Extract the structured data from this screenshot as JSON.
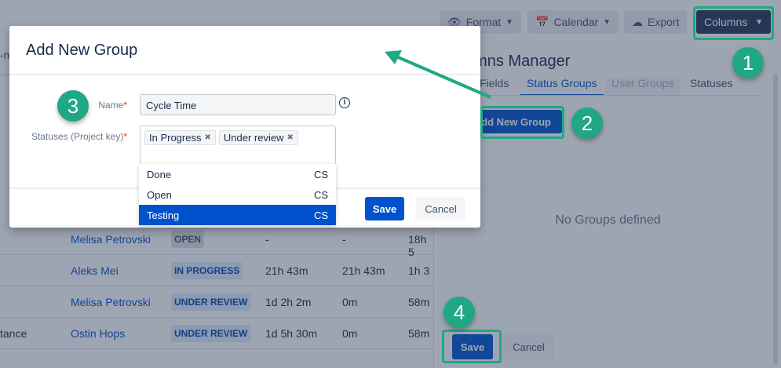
{
  "toolbar": {
    "format": "Format",
    "calendar": "Calendar",
    "export": "Export",
    "columns": "Columns"
  },
  "table": {
    "rows": [
      {
        "summary": "",
        "assignee": "Melisa Petrovski",
        "status": "OPEN",
        "status_color": "gray",
        "c1": "-",
        "c2": "-",
        "c3": "18h 5"
      },
      {
        "summary": "",
        "assignee": "Aleks Mei",
        "status": "IN PROGRESS",
        "status_color": "blue",
        "c1": "21h 43m",
        "c2": "21h 43m",
        "c3": "1h 3"
      },
      {
        "summary": "",
        "assignee": "Melisa Petrovski",
        "status": "UNDER REVIEW",
        "status_color": "blue",
        "c1": "1d 2h 2m",
        "c2": "0m",
        "c3": "58m"
      },
      {
        "summary": "tance",
        "assignee": "Ostin Hops",
        "status": "UNDER REVIEW",
        "status_color": "blue",
        "c1": "1d 5h 30m",
        "c2": "0m",
        "c3": "58m"
      }
    ],
    "left_fragment": "-m"
  },
  "panel": {
    "title": "Columns Manager",
    "tabs": [
      "Fields",
      "Status Groups",
      "User Groups",
      "Statuses"
    ],
    "active_tab": "Status Groups",
    "add_button": "Add New Group",
    "empty": "No Groups defined",
    "save": "Save",
    "cancel": "Cancel"
  },
  "dialog": {
    "title": "Add New Group",
    "name_label": "Name",
    "name_value": "Cycle Time",
    "statuses_label": "Statuses (Project key)",
    "required_mark": "*",
    "chips": [
      "In Progress",
      "Under review"
    ],
    "options": [
      {
        "label": "Done",
        "key": "CS"
      },
      {
        "label": "Open",
        "key": "CS"
      },
      {
        "label": "Testing",
        "key": "CS",
        "selected": true
      }
    ],
    "save": "Save",
    "cancel": "Cancel"
  },
  "annotations": [
    "1",
    "2",
    "3",
    "4"
  ],
  "colors": {
    "accent": "#0052cc",
    "annotation": "#1fa883",
    "columns_button": "#253858"
  }
}
